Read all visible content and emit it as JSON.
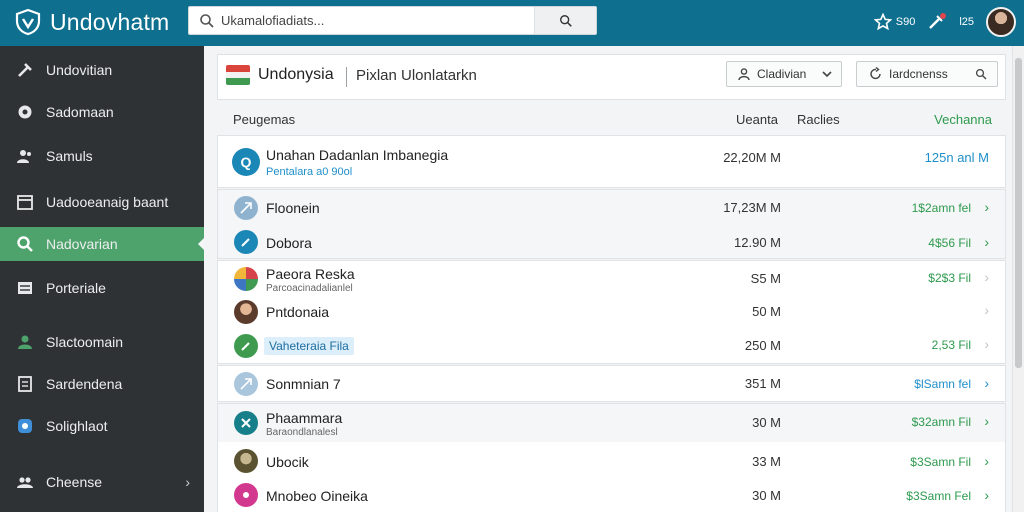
{
  "app": {
    "title": "Undovhatm",
    "search_placeholder": "Ukamalofiadiats...",
    "top_right": {
      "item1_label": "S90",
      "item2_label": "",
      "item3_label": "l25"
    }
  },
  "sidebar": {
    "items": [
      {
        "label": "Undovitian",
        "icon": "dashboard-icon"
      },
      {
        "label": "Sadomaan",
        "icon": "settings-icon"
      },
      {
        "label": "Samuls",
        "icon": "users-icon"
      },
      {
        "label": "Uadooeanaig baant",
        "icon": "calendar-icon"
      },
      {
        "label": "Nadovarian",
        "icon": "search-icon"
      },
      {
        "label": "Porteriale",
        "icon": "list-icon"
      },
      {
        "label": "Slactoomain",
        "icon": "user-icon"
      },
      {
        "label": "Sardendena",
        "icon": "document-icon"
      },
      {
        "label": "Solighlaot",
        "icon": "chat-icon"
      },
      {
        "label": "Cheense",
        "icon": "team-icon"
      }
    ]
  },
  "panel": {
    "country": "Undonysia",
    "subtitle": "Pixlan Ulonlatarkn",
    "dropdown1_label": "Cladivian",
    "dropdown2_label": "Iardcnenss"
  },
  "table": {
    "headers": {
      "name": "Peugemas",
      "value": "Ueanta",
      "raches": "Raclies",
      "status": "Vechanna"
    },
    "rows": [
      {
        "name": "Unahan Dadanlan Imbanegia",
        "sub": "Pentalara a0 90ol",
        "value": "22,20M M",
        "status": "125n anl M"
      },
      {
        "name": "Floonein",
        "sub": "",
        "value": "17,23M M",
        "status": "1$2amn fel"
      },
      {
        "name": "Dobora",
        "sub": "",
        "value": "12.90 M",
        "status": "4$56 Fil"
      },
      {
        "name": "Paeora Reska",
        "sub": "Parcoacinadalianlel",
        "value": "S5 M",
        "status": "$2$3 Fil"
      },
      {
        "name": "Pntdonaia",
        "sub": "",
        "value": "50 M",
        "status": ""
      },
      {
        "name": "Vaheteraia Fila",
        "sub": "",
        "value": "250 M",
        "status": "2,53 Fil"
      },
      {
        "name": "Sonmnian 7",
        "sub": "",
        "value": "351 M",
        "status": "$lSamn fel"
      },
      {
        "name": "Phaammara",
        "sub": "Baraondlanalesl",
        "value": "30 M",
        "status": "$32amn Fil"
      },
      {
        "name": "Ubocik",
        "sub": "",
        "value": "33 M",
        "status": "$3Samn Fil"
      },
      {
        "name": "Mnobeo Oineika",
        "sub": "",
        "value": "30 M",
        "status": "$3Samn Fel"
      }
    ]
  }
}
